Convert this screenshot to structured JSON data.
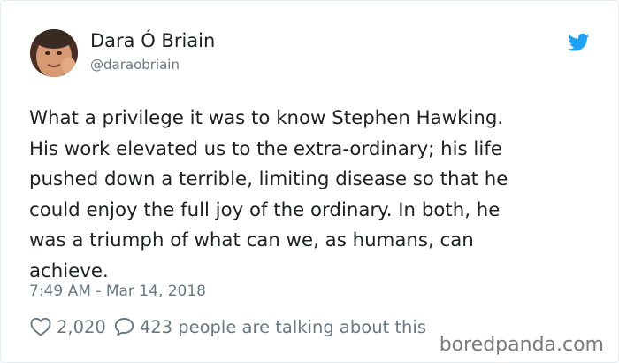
{
  "author": {
    "name": "Dara Ó Briain",
    "handle": "@daraobriain",
    "avatar_icon": "profile-photo"
  },
  "tweet": {
    "text": "What a privilege it was to know Stephen Hawking.\nHis work elevated us to the extra-ordinary; his life\npushed down a terrible, limiting disease so that he\ncould enjoy the full joy of the ordinary. In both, he\nwas a triumph of what can we, as humans, can\nachieve.",
    "timestamp": "7:49 AM - Mar 14, 2018"
  },
  "engagement": {
    "likes": "2,020",
    "replies_text": "423 people are talking about this",
    "like_icon": "heart-icon",
    "reply_icon": "speech-bubble-icon"
  },
  "brand": {
    "icon": "twitter-bird-icon",
    "color": "#1da1f2"
  },
  "watermark": "boredpanda.com"
}
